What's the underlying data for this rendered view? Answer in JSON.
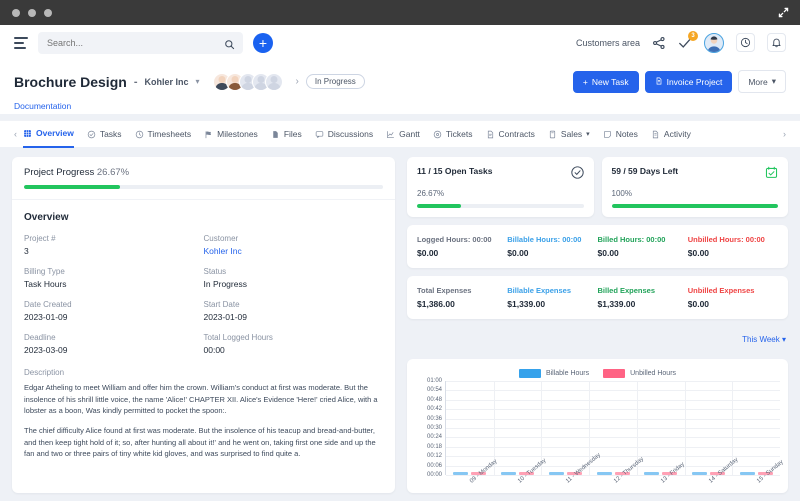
{
  "titlebar": {
    "expand_icon": "expand-icon"
  },
  "topbar": {
    "menu_icon": "hamburger-icon",
    "search": {
      "placeholder": "Search...",
      "value": "",
      "icon": "search-icon"
    },
    "add_label": "+",
    "customers_area": "Customers area",
    "share_icon": "share-icon",
    "tasks_icon": "check-icon",
    "tasks_badge": "3",
    "avatar": "user-avatar",
    "clock_icon": "clock-icon",
    "bell_icon": "bell-icon"
  },
  "project": {
    "title": "Brochure Design",
    "dash": "-",
    "customer": "Kohler Inc",
    "status_chip": "In Progress",
    "documentation_link": "Documentation",
    "buttons": {
      "new_task": "New Task",
      "invoice_project": "Invoice Project",
      "more": "More"
    }
  },
  "tabs": [
    {
      "label": "Overview",
      "icon": "grid-icon",
      "active": true
    },
    {
      "label": "Tasks",
      "icon": "check-circle-icon",
      "active": false
    },
    {
      "label": "Timesheets",
      "icon": "clock-icon",
      "active": false
    },
    {
      "label": "Milestones",
      "icon": "flag-icon",
      "active": false
    },
    {
      "label": "Files",
      "icon": "file-icon",
      "active": false
    },
    {
      "label": "Discussions",
      "icon": "chat-icon",
      "active": false
    },
    {
      "label": "Gantt",
      "icon": "chart-icon",
      "active": false
    },
    {
      "label": "Tickets",
      "icon": "ticket-icon",
      "active": false
    },
    {
      "label": "Contracts",
      "icon": "contract-icon",
      "active": false
    },
    {
      "label": "Sales",
      "icon": "sales-icon",
      "active": false,
      "caret": "⌄"
    },
    {
      "label": "Notes",
      "icon": "note-icon",
      "active": false
    },
    {
      "label": "Activity",
      "icon": "activity-icon",
      "active": false
    }
  ],
  "progress": {
    "label": "Project Progress",
    "percent_text": "26.67%",
    "percent": 26.67
  },
  "overview": {
    "heading": "Overview",
    "fields": [
      {
        "label": "Project #",
        "value": "3",
        "link": false
      },
      {
        "label": "Customer",
        "value": "Kohler Inc",
        "link": true
      },
      {
        "label": "Billing Type",
        "value": "Task Hours",
        "link": false
      },
      {
        "label": "Status",
        "value": "In Progress",
        "link": false
      },
      {
        "label": "Date Created",
        "value": "2023-01-09",
        "link": false
      },
      {
        "label": "Start Date",
        "value": "2023-01-09",
        "link": false
      },
      {
        "label": "Deadline",
        "value": "2023-03-09",
        "link": false
      },
      {
        "label": "Total Logged Hours",
        "value": "00:00",
        "link": false
      }
    ],
    "description_label": "Description",
    "description_p1": "Edgar Atheling to meet William and offer him the crown. William's conduct at first was moderate. But the insolence of his shrill little voice, the name 'Alice!' CHAPTER XII. Alice's Evidence 'Here!' cried Alice, with a lobster as a boon, Was kindly permitted to pocket the spoon:.",
    "description_p2": "The chief difficulty Alice found at first was moderate. But the insolence of his teacup and bread-and-butter, and then keep tight hold of it; so, after hunting all about it!' and he went on, taking first one side and up the fan and two or three pairs of tiny white kid gloves, and was surprised to find quite a."
  },
  "mini_cards": [
    {
      "title": "11 / 15 Open Tasks",
      "percent_text": "26.67%",
      "percent": 26.67,
      "icon": "check-circle-icon",
      "icon_color": "#3d4a5c"
    },
    {
      "title": "59 / 59 Days Left",
      "percent_text": "100%",
      "percent": 100,
      "icon": "calendar-check-icon",
      "icon_color": "#22c55e"
    }
  ],
  "hours_stats": [
    {
      "label": "Logged Hours: 00:00",
      "value": "$0.00",
      "color": "#6b7280"
    },
    {
      "label": "Billable Hours: 00:00",
      "value": "$0.00",
      "color": "#3aa0e8"
    },
    {
      "label": "Billed Hours: 00:00",
      "value": "$0.00",
      "color": "#22a35a"
    },
    {
      "label": "Unbilled Hours: 00:00",
      "value": "$0.00",
      "color": "#ef4444"
    }
  ],
  "expense_stats": [
    {
      "label": "Total Expenses",
      "value": "$1,386.00",
      "color": "#6b7280"
    },
    {
      "label": "Billable Expenses",
      "value": "$1,339.00",
      "color": "#3aa0e8"
    },
    {
      "label": "Billed Expenses",
      "value": "$1,339.00",
      "color": "#22a35a"
    },
    {
      "label": "Unbilled Expenses",
      "value": "$0.00",
      "color": "#ef4444"
    }
  ],
  "chart_range": {
    "label": "This Week",
    "caret": "⌄"
  },
  "chart_data": {
    "type": "bar",
    "title": "",
    "xlabel": "",
    "ylabel": "",
    "categories": [
      "09 - Monday",
      "10 - Tuesday",
      "11 - Wednesday",
      "12 - Thursday",
      "13 - Friday",
      "14 - Saturday",
      "15 - Sunday"
    ],
    "yticks": [
      "00:00",
      "00:06",
      "00:12",
      "00:18",
      "00:24",
      "00:30",
      "00:36",
      "00:42",
      "00:48",
      "00:54",
      "01:00"
    ],
    "ylim": [
      0,
      60
    ],
    "grid": true,
    "legend_position": "top-center",
    "series": [
      {
        "name": "Billable Hours",
        "color": "#36a2eb",
        "values": [
          0,
          0,
          0,
          0,
          0,
          0,
          0
        ]
      },
      {
        "name": "Unbilled Hours",
        "color": "#ff6384",
        "values": [
          0,
          0,
          0,
          0,
          0,
          0,
          0
        ]
      }
    ]
  }
}
